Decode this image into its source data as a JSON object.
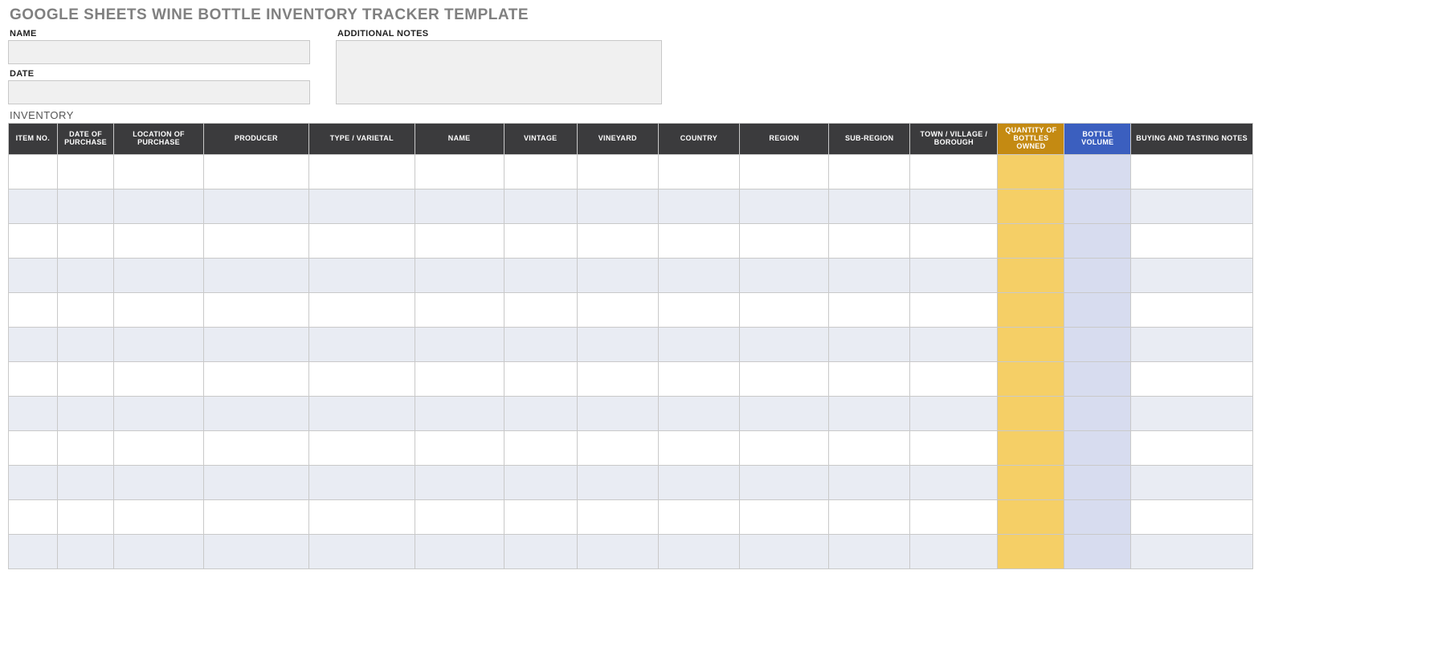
{
  "title": "GOOGLE SHEETS WINE BOTTLE INVENTORY TRACKER TEMPLATE",
  "meta": {
    "name_label": "NAME",
    "name_value": "",
    "date_label": "DATE",
    "date_value": "",
    "notes_label": "ADDITIONAL NOTES",
    "notes_value": ""
  },
  "section_label": "INVENTORY",
  "columns": [
    {
      "key": "item_no",
      "label": "ITEM NO."
    },
    {
      "key": "date_purchase",
      "label": "DATE OF PURCHASE"
    },
    {
      "key": "location",
      "label": "LOCATION OF PURCHASE"
    },
    {
      "key": "producer",
      "label": "PRODUCER"
    },
    {
      "key": "type_varietal",
      "label": "TYPE / VARIETAL"
    },
    {
      "key": "name",
      "label": "NAME"
    },
    {
      "key": "vintage",
      "label": "VINTAGE"
    },
    {
      "key": "vineyard",
      "label": "VINEYARD"
    },
    {
      "key": "country",
      "label": "COUNTRY"
    },
    {
      "key": "region",
      "label": "REGION"
    },
    {
      "key": "sub_region",
      "label": "SUB-REGION"
    },
    {
      "key": "town",
      "label": "TOWN / VILLAGE / BOROUGH"
    },
    {
      "key": "qty_owned",
      "label": "QUANTITY OF BOTTLES OWNED"
    },
    {
      "key": "bottle_volume",
      "label": "BOTTLE VOLUME"
    },
    {
      "key": "buy_notes",
      "label": "BUYING AND TASTING NOTES"
    }
  ],
  "rows": [
    {
      "item_no": "",
      "date_purchase": "",
      "location": "",
      "producer": "",
      "type_varietal": "",
      "name": "",
      "vintage": "",
      "vineyard": "",
      "country": "",
      "region": "",
      "sub_region": "",
      "town": "",
      "qty_owned": "",
      "bottle_volume": "",
      "buy_notes": ""
    },
    {
      "item_no": "",
      "date_purchase": "",
      "location": "",
      "producer": "",
      "type_varietal": "",
      "name": "",
      "vintage": "",
      "vineyard": "",
      "country": "",
      "region": "",
      "sub_region": "",
      "town": "",
      "qty_owned": "",
      "bottle_volume": "",
      "buy_notes": ""
    },
    {
      "item_no": "",
      "date_purchase": "",
      "location": "",
      "producer": "",
      "type_varietal": "",
      "name": "",
      "vintage": "",
      "vineyard": "",
      "country": "",
      "region": "",
      "sub_region": "",
      "town": "",
      "qty_owned": "",
      "bottle_volume": "",
      "buy_notes": ""
    },
    {
      "item_no": "",
      "date_purchase": "",
      "location": "",
      "producer": "",
      "type_varietal": "",
      "name": "",
      "vintage": "",
      "vineyard": "",
      "country": "",
      "region": "",
      "sub_region": "",
      "town": "",
      "qty_owned": "",
      "bottle_volume": "",
      "buy_notes": ""
    },
    {
      "item_no": "",
      "date_purchase": "",
      "location": "",
      "producer": "",
      "type_varietal": "",
      "name": "",
      "vintage": "",
      "vineyard": "",
      "country": "",
      "region": "",
      "sub_region": "",
      "town": "",
      "qty_owned": "",
      "bottle_volume": "",
      "buy_notes": ""
    },
    {
      "item_no": "",
      "date_purchase": "",
      "location": "",
      "producer": "",
      "type_varietal": "",
      "name": "",
      "vintage": "",
      "vineyard": "",
      "country": "",
      "region": "",
      "sub_region": "",
      "town": "",
      "qty_owned": "",
      "bottle_volume": "",
      "buy_notes": ""
    },
    {
      "item_no": "",
      "date_purchase": "",
      "location": "",
      "producer": "",
      "type_varietal": "",
      "name": "",
      "vintage": "",
      "vineyard": "",
      "country": "",
      "region": "",
      "sub_region": "",
      "town": "",
      "qty_owned": "",
      "bottle_volume": "",
      "buy_notes": ""
    },
    {
      "item_no": "",
      "date_purchase": "",
      "location": "",
      "producer": "",
      "type_varietal": "",
      "name": "",
      "vintage": "",
      "vineyard": "",
      "country": "",
      "region": "",
      "sub_region": "",
      "town": "",
      "qty_owned": "",
      "bottle_volume": "",
      "buy_notes": ""
    },
    {
      "item_no": "",
      "date_purchase": "",
      "location": "",
      "producer": "",
      "type_varietal": "",
      "name": "",
      "vintage": "",
      "vineyard": "",
      "country": "",
      "region": "",
      "sub_region": "",
      "town": "",
      "qty_owned": "",
      "bottle_volume": "",
      "buy_notes": ""
    },
    {
      "item_no": "",
      "date_purchase": "",
      "location": "",
      "producer": "",
      "type_varietal": "",
      "name": "",
      "vintage": "",
      "vineyard": "",
      "country": "",
      "region": "",
      "sub_region": "",
      "town": "",
      "qty_owned": "",
      "bottle_volume": "",
      "buy_notes": ""
    },
    {
      "item_no": "",
      "date_purchase": "",
      "location": "",
      "producer": "",
      "type_varietal": "",
      "name": "",
      "vintage": "",
      "vineyard": "",
      "country": "",
      "region": "",
      "sub_region": "",
      "town": "",
      "qty_owned": "",
      "bottle_volume": "",
      "buy_notes": ""
    },
    {
      "item_no": "",
      "date_purchase": "",
      "location": "",
      "producer": "",
      "type_varietal": "",
      "name": "",
      "vintage": "",
      "vineyard": "",
      "country": "",
      "region": "",
      "sub_region": "",
      "town": "",
      "qty_owned": "",
      "bottle_volume": "",
      "buy_notes": ""
    }
  ],
  "colors": {
    "header_bg": "#3b3b3d",
    "qty_header_bg": "#c48a12",
    "vol_header_bg": "#3b5fbf",
    "qty_cell_bg": "#f5cf66",
    "vol_cell_bg": "#d7dcef",
    "alt_row_bg": "#e9ecf3"
  }
}
